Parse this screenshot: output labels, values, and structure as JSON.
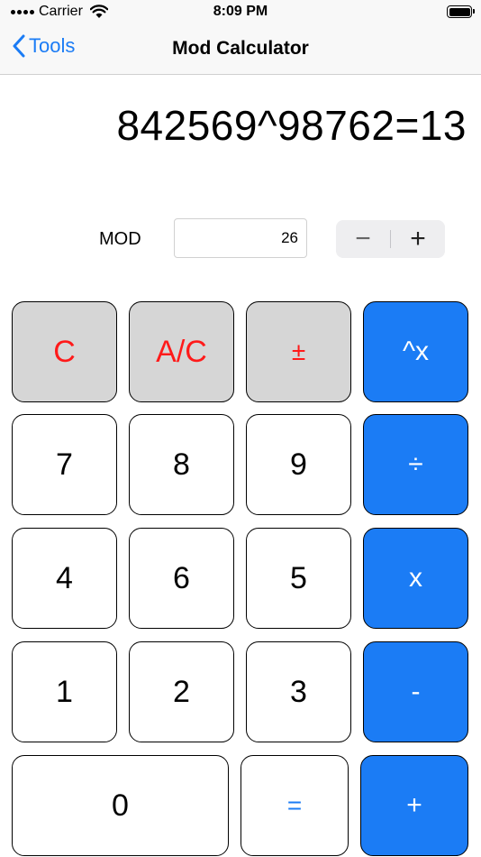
{
  "status_bar": {
    "carrier": "Carrier",
    "time": "8:09 PM"
  },
  "nav": {
    "back_label": "Tools",
    "title": "Mod Calculator"
  },
  "display": {
    "expression": "842569^98762=13"
  },
  "mod": {
    "label": "MOD",
    "value": "26",
    "stepper_minus": "−",
    "stepper_plus": "+"
  },
  "keypad": {
    "clear": "C",
    "all_clear": "A/C",
    "plus_minus": "±",
    "power": "^x",
    "seven": "7",
    "eight": "8",
    "nine": "9",
    "divide": "÷",
    "four": "4",
    "six": "6",
    "five": "5",
    "multiply": "x",
    "one": "1",
    "two": "2",
    "three": "3",
    "subtract": "-",
    "zero": "0",
    "equals": "=",
    "add": "+"
  },
  "colors": {
    "accent_blue": "#1b7cf5",
    "function_gray": "#d6d6d6",
    "function_red": "#ff1a1a"
  },
  "icons": {
    "back": "chevron-left-icon",
    "wifi": "wifi-icon",
    "battery": "battery-icon"
  }
}
